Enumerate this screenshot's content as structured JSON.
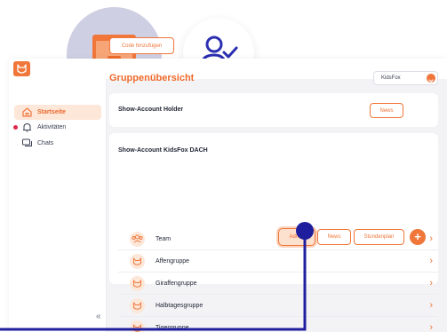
{
  "header": {
    "logo_icon": "fox-logo-icon",
    "feature_icons": [
      "desktop-profile-icon",
      "user-check-icon"
    ]
  },
  "sidebar": {
    "items": [
      {
        "label": "Startseite",
        "icon": "home-icon",
        "active": true
      },
      {
        "label": "Aktivitäten",
        "icon": "bell-icon",
        "badge": true
      },
      {
        "label": "Chats",
        "icon": "chat-icon"
      }
    ],
    "collapse_label": "«"
  },
  "main": {
    "code_button": "Code hinzufügen",
    "title": "Gruppenübersicht",
    "org_select": "KidsFox",
    "cards": [
      {
        "title": "Show-Account Holder",
        "news_button": "News"
      },
      {
        "title": "Show-Account KidsFox DACH",
        "admin_button": "Admin",
        "news_button": "News",
        "schedule_button": "Stundenplan",
        "add_button": "+",
        "groups": [
          "Team",
          "Affengruppe",
          "Giraffengruppe",
          "Halbtagesgruppe",
          "Tigergruppe"
        ]
      }
    ],
    "chevron": "›"
  },
  "colors": {
    "accent": "#f0763a",
    "accent_light": "#fde7d9",
    "annotation": "#1f1f9e",
    "badge": "#e2274f"
  }
}
